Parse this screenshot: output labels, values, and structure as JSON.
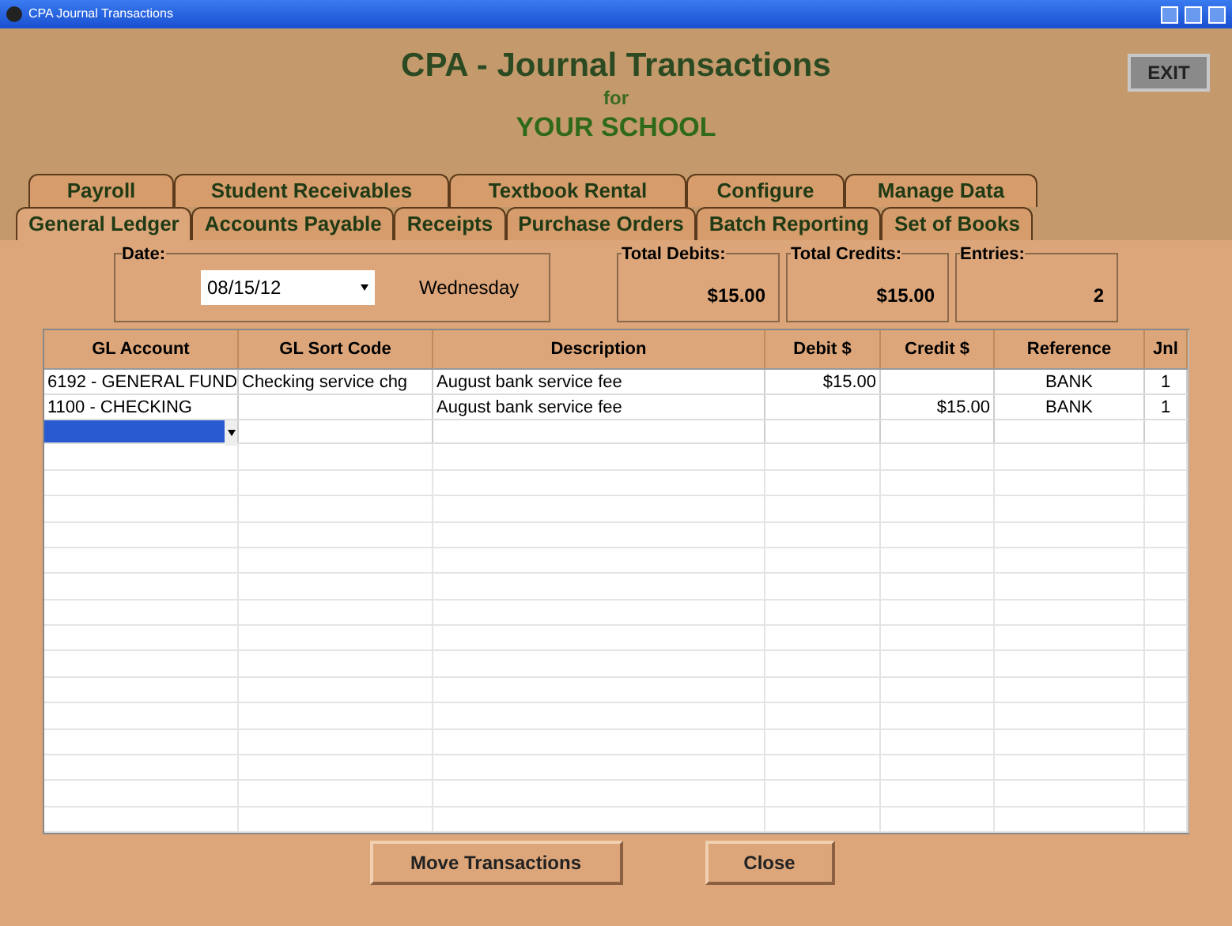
{
  "window": {
    "title": "CPA Journal Transactions"
  },
  "header": {
    "title": "CPA - Journal Transactions",
    "for": "for",
    "school": "YOUR SCHOOL",
    "exit": "EXIT"
  },
  "tab_rows": [
    [
      {
        "label": "Payroll",
        "selected": false
      },
      {
        "label": "Student Receivables",
        "selected": false
      },
      {
        "label": "Textbook Rental",
        "selected": false
      },
      {
        "label": "Configure",
        "selected": false
      },
      {
        "label": "Manage Data",
        "selected": false
      }
    ],
    [
      {
        "label": "General Ledger",
        "selected": true
      },
      {
        "label": "Accounts Payable",
        "selected": false
      },
      {
        "label": "Receipts",
        "selected": false
      },
      {
        "label": "Purchase Orders",
        "selected": false
      },
      {
        "label": "Batch Reporting",
        "selected": false
      },
      {
        "label": "Set of Books",
        "selected": false
      }
    ]
  ],
  "date": {
    "label": "Date:",
    "value": "08/15/12",
    "weekday": "Wednesday"
  },
  "totals": [
    {
      "label": "Total Debits:",
      "value": "$15.00"
    },
    {
      "label": "Total Credits:",
      "value": "$15.00"
    },
    {
      "label": "Entries:",
      "value": "2"
    }
  ],
  "table": {
    "columns": [
      "GL Account",
      "GL Sort Code",
      "Description",
      "Debit $",
      "Credit $",
      "Reference",
      "Jnl"
    ],
    "rows": [
      {
        "cells": [
          "6192 - GENERAL FUND",
          "Checking service chg",
          "August bank service fee",
          "$15.00",
          "",
          "BANK",
          "1"
        ],
        "selected": false
      },
      {
        "cells": [
          "1100 - CHECKING",
          "",
          "August bank service fee",
          "",
          "$15.00",
          "BANK",
          "1"
        ],
        "selected": false
      },
      {
        "cells": [
          "",
          "",
          "",
          "",
          "",
          "",
          ""
        ],
        "selected": true
      }
    ]
  },
  "buttons": [
    "Move Transactions",
    "Close"
  ]
}
